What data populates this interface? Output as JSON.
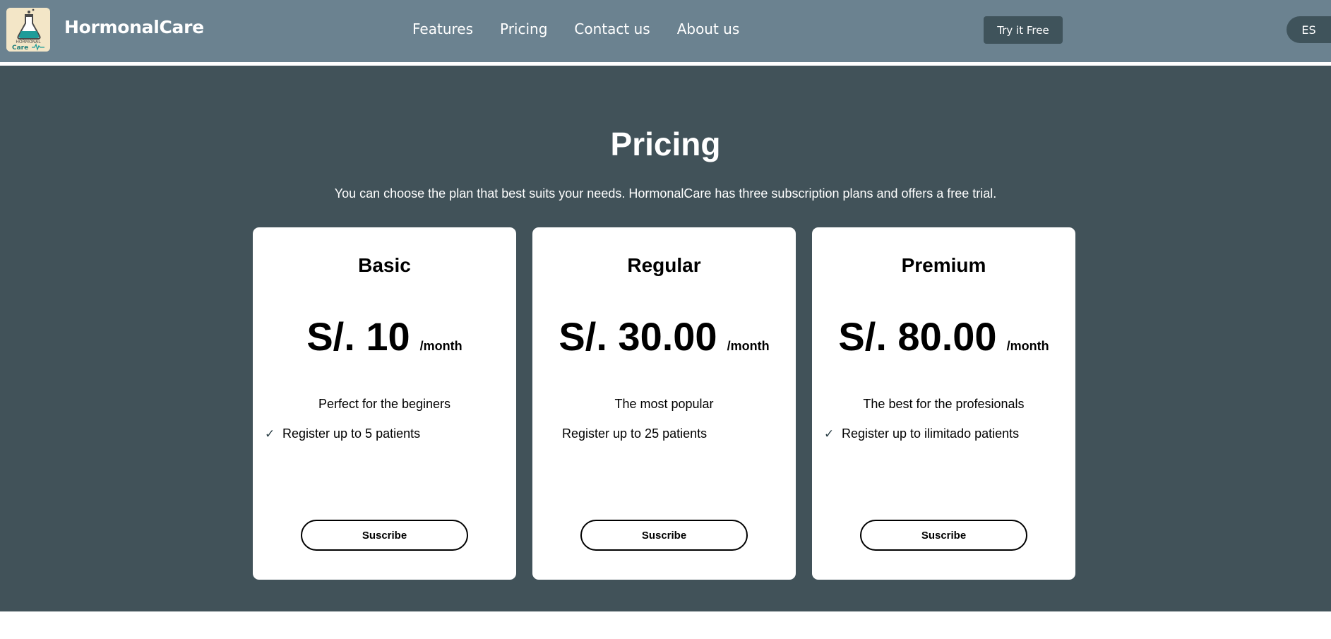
{
  "header": {
    "brand": "HormonalCare",
    "nav": [
      "Features",
      "Pricing",
      "Contact us",
      "About us"
    ],
    "try_label": "Try it Free",
    "lang_label": "ES",
    "logo": {
      "line1": "HORMONAL",
      "line2": "Care"
    }
  },
  "pricing": {
    "title": "Pricing",
    "subtitle": "You can choose the plan that best suits your needs. HormonalCare has three subscription plans and offers a free trial.",
    "plans": [
      {
        "name": "Basic",
        "price": "S/. 10",
        "period": "/month",
        "tagline": "Perfect for the beginers",
        "feature": "Register up to 5 patients",
        "check": "✓",
        "button": "Suscribe"
      },
      {
        "name": "Regular",
        "price": "S/. 30.00",
        "period": "/month",
        "tagline": "The most popular",
        "feature": "Register up to 25 patients",
        "check": "",
        "button": "Suscribe"
      },
      {
        "name": "Premium",
        "price": "S/. 80.00",
        "period": "/month",
        "tagline": "The best for the profesionals",
        "feature": "Register up to ilimitado patients",
        "check": "✓",
        "button": "Suscribe"
      }
    ]
  },
  "colors": {
    "header_bg": "#6b8290",
    "section_bg": "#415259",
    "button_dark": "#3f535b",
    "card_bg": "#ffffff"
  }
}
